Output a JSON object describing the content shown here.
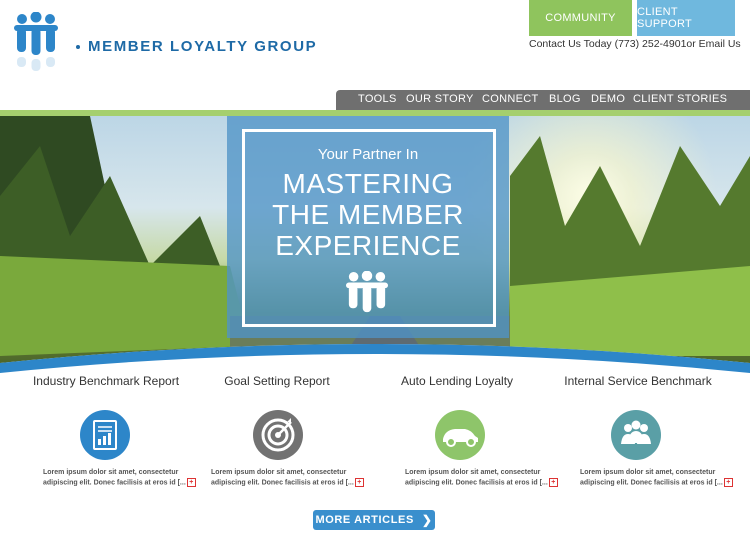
{
  "header": {
    "brand": "MEMBER LOYALTY GROUP",
    "community_label": "COMMUNITY",
    "support_label": "CLIENT SUPPORT",
    "contact_text": "Contact Us Today (773) 252-4901or Email Us"
  },
  "nav": {
    "items": [
      "TOOLS",
      "OUR STORY",
      "CONNECT",
      "BLOG",
      "DEMO",
      "CLIENT STORIES"
    ]
  },
  "hero": {
    "subtitle": "Your Partner In",
    "title_line1": "MASTERING",
    "title_line2": "THE MEMBER",
    "title_line3": "EXPERIENCE"
  },
  "cards": [
    {
      "title": "Industry Benchmark Report",
      "icon": "report-chart-icon",
      "text": "Lorem ipsum dolor sit amet, consectetur adipiscing elit. Donec facilisis at eros id [..."
    },
    {
      "title": "Goal Setting Report",
      "icon": "target-icon",
      "text": "Lorem ipsum dolor sit amet, consectetur adipiscing elit. Donec facilisis at eros id [..."
    },
    {
      "title": "Auto Lending Loyalty",
      "icon": "car-icon",
      "text": "Lorem ipsum dolor sit amet, consectetur adipiscing elit. Donec facilisis at eros id [..."
    },
    {
      "title": "Internal Service Benchmark",
      "icon": "group-people-icon",
      "text": "Lorem ipsum dolor sit amet, consectetur adipiscing elit. Donec facilisis at eros id [..."
    }
  ],
  "more_articles_label": "MORE ARTICLES",
  "colors": {
    "brand_blue": "#1e6aa6",
    "community_green": "#8fc45d",
    "support_blue": "#6fb8de",
    "nav_gray": "#6f6f6f",
    "icon_blue": "#2d86c9",
    "icon_gray": "#727272",
    "icon_green": "#8ec56a",
    "icon_teal": "#5a9fa6"
  }
}
